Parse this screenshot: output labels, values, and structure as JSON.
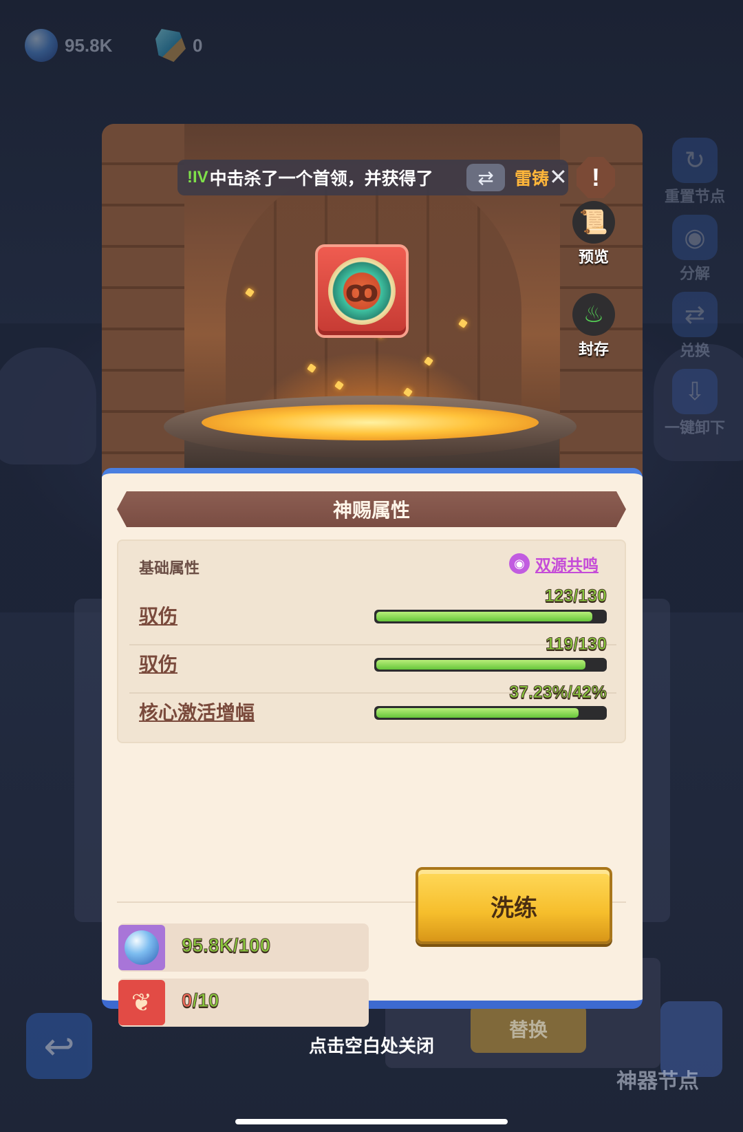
{
  "background": {
    "currency_orb_amount": "95.8K",
    "currency_gem_amount": "0",
    "side_buttons": [
      {
        "label": "重置节点",
        "icon": "reset-icon",
        "glyph": "↻"
      },
      {
        "label": "分解",
        "icon": "decompose-icon",
        "glyph": "◉"
      },
      {
        "label": "兑换",
        "icon": "exchange-icon",
        "glyph": "⇄"
      },
      {
        "label": "一键卸下",
        "icon": "unequip-all-icon",
        "glyph": "⇩"
      }
    ],
    "replace_label": "替换",
    "artifact_node_label": "神器节点"
  },
  "notice": {
    "level_tag": "!IV",
    "message": "中击杀了一个首领，并获得了",
    "item_name": "雷铸"
  },
  "side_actions": {
    "preview_label": "预览",
    "seal_label": "封存"
  },
  "panel": {
    "title": "神赐属性",
    "section_label": "基础属性",
    "resonance_label": "双源共鸣",
    "attributes": [
      {
        "name": "驭伤",
        "value_text": "123/130",
        "fraction": 0.946
      },
      {
        "name": "驭伤",
        "value_text": "119/130",
        "fraction": 0.915
      },
      {
        "name": "核心激活增幅",
        "value_text": "37.23%/42%",
        "fraction": 0.886
      }
    ],
    "costs": [
      {
        "have": "95.8K",
        "need": "/100",
        "icon": "spirit-orb-icon",
        "enough": true
      },
      {
        "have": "0",
        "need": "/10",
        "icon": "flame-crystal-icon",
        "enough": false
      }
    ],
    "refine_label": "洗练"
  },
  "footer": {
    "tap_to_close": "点击空白处关闭"
  },
  "colors": {
    "accent_blue": "#4a7fe0",
    "bar_green": "#66c63a",
    "value_green": "#8ac83d",
    "insufficient_red": "#f26a5a",
    "refine_gold": "#f6be2c"
  }
}
